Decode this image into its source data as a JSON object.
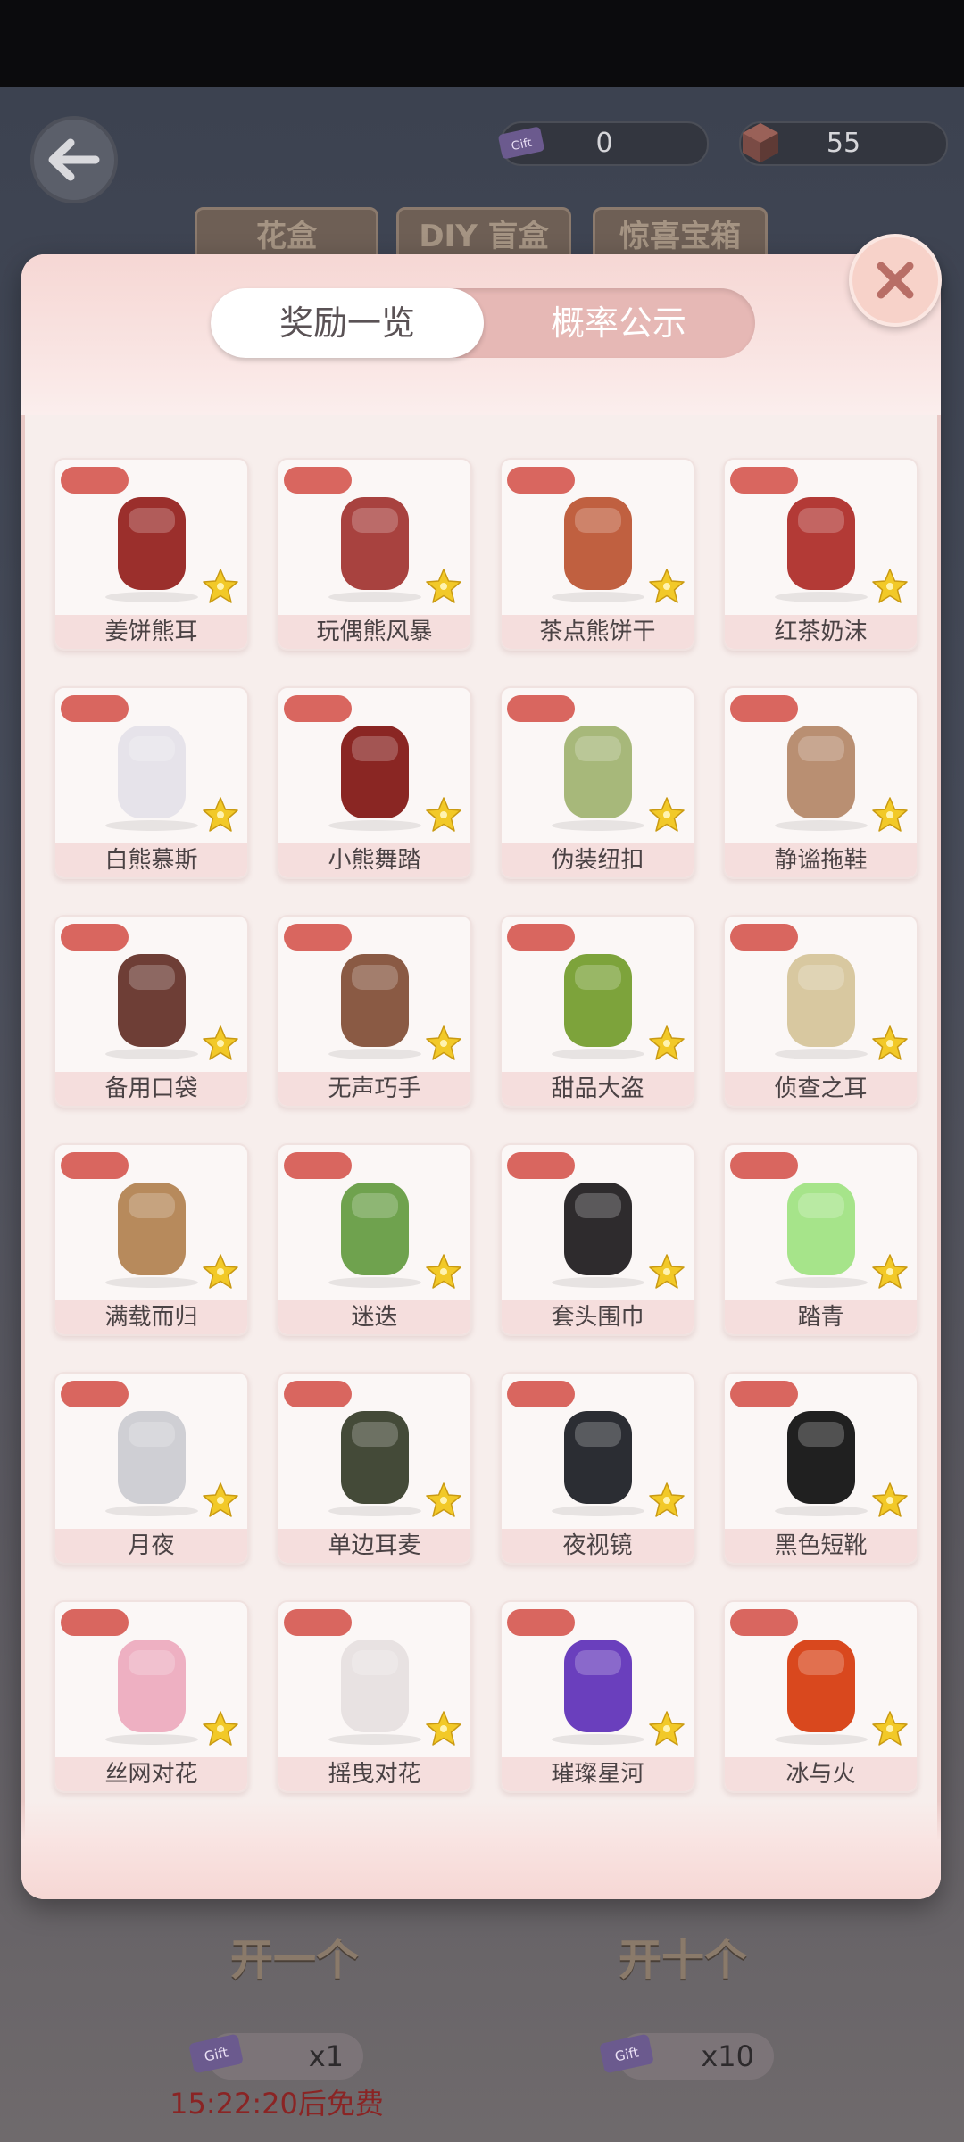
{
  "currency": [
    {
      "icon": "gift-ticket-icon",
      "value": "0"
    },
    {
      "icon": "gem-cube-icon",
      "value": "55"
    }
  ],
  "background_tabs": [
    "花盒",
    "DIY 盲盒",
    "惊喜宝箱"
  ],
  "modal": {
    "tabs": {
      "rewards": "奖励一览",
      "probability": "概率公示"
    },
    "items": [
      {
        "name": "姜饼熊耳",
        "icon": "bear-ear-headband-icon"
      },
      {
        "name": "玩偶熊风暴",
        "icon": "bear-dress-icon"
      },
      {
        "name": "茶点熊饼干",
        "icon": "bear-earrings-icon"
      },
      {
        "name": "红茶奶沫",
        "icon": "frilly-socks-icon"
      },
      {
        "name": "白熊慕斯",
        "icon": "white-socks-icon"
      },
      {
        "name": "小熊舞踏",
        "icon": "red-shoes-icon"
      },
      {
        "name": "伪装纽扣",
        "icon": "green-buttons-icon"
      },
      {
        "name": "静谧拖鞋",
        "icon": "reindeer-slippers-icon"
      },
      {
        "name": "备用口袋",
        "icon": "striped-boots-icon"
      },
      {
        "name": "无声巧手",
        "icon": "fur-gloves-icon"
      },
      {
        "name": "甜品大盗",
        "icon": "green-braids-wig-icon"
      },
      {
        "name": "侦查之耳",
        "icon": "knit-hat-icon"
      },
      {
        "name": "满载而归",
        "icon": "patchwork-outfit-icon"
      },
      {
        "name": "迷迭",
        "icon": "green-jacket-outfit-icon"
      },
      {
        "name": "套头围巾",
        "icon": "black-snood-icon"
      },
      {
        "name": "踏青",
        "icon": "green-socks-icon"
      },
      {
        "name": "月夜",
        "icon": "silver-hair-wig-icon"
      },
      {
        "name": "单边耳麦",
        "icon": "headset-mic-icon"
      },
      {
        "name": "夜视镜",
        "icon": "night-goggles-icon"
      },
      {
        "name": "黑色短靴",
        "icon": "black-boots-icon"
      },
      {
        "name": "丝网对花",
        "icon": "pink-flower-clip-icon"
      },
      {
        "name": "摇曳对花",
        "icon": "white-flower-tassel-icon"
      },
      {
        "name": "璀璨星河",
        "icon": "purple-eyes-icon"
      },
      {
        "name": "冰与火",
        "icon": "fire-ice-eyes-icon"
      }
    ]
  },
  "bottom": {
    "open_one": "开一个",
    "open_ten": "开十个",
    "cost_one": "x1",
    "cost_ten": "x10",
    "free_timer": "15:22:20后免费"
  },
  "colors": {
    "accent": "#d9665f",
    "star": "#f2c928",
    "panel": "#f7eeec"
  }
}
